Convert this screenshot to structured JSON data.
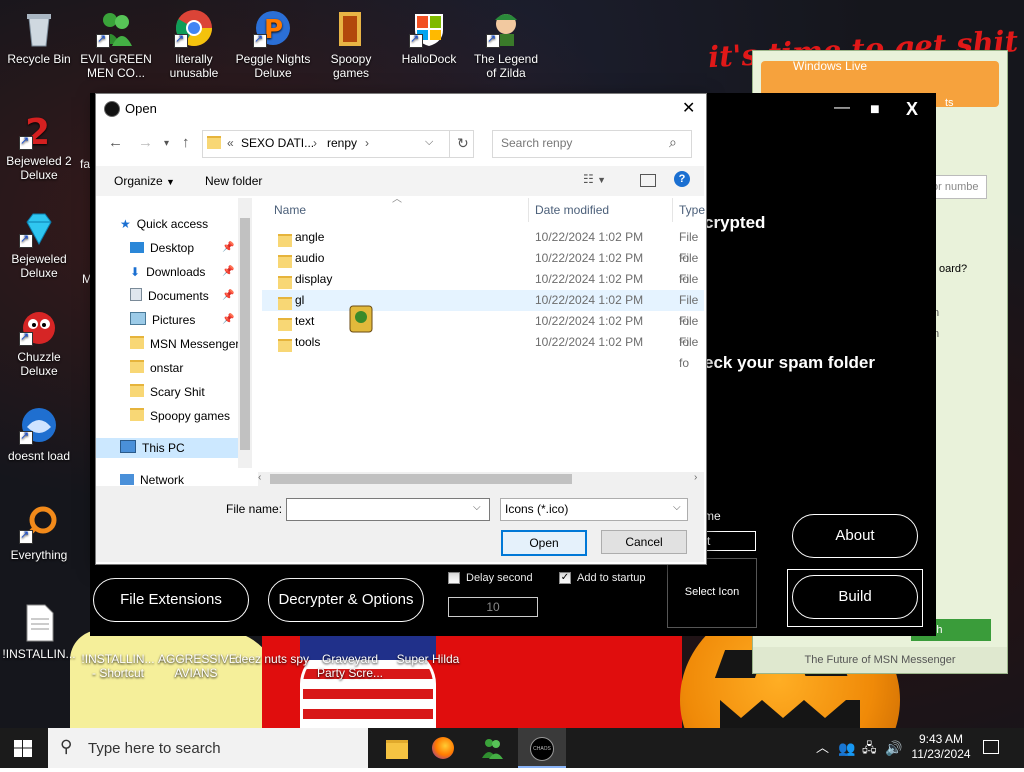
{
  "desktop": {
    "wallpaper_text": "it's time to get shit",
    "top_icons": [
      {
        "label": "Recycle Bin"
      },
      {
        "label": "EVIL GREEN MEN CO..."
      },
      {
        "label": "literally unusable"
      },
      {
        "label": "Peggle Nights Deluxe"
      },
      {
        "label": "Spoopy games"
      },
      {
        "label": "HalloDock"
      },
      {
        "label": "The Legend of Zilda"
      }
    ],
    "left_icons": [
      {
        "label": "Bejeweled 2 Deluxe"
      },
      {
        "label": "Bejeweled Deluxe"
      },
      {
        "label": "Chuzzle Deluxe"
      },
      {
        "label": "doesnt load"
      },
      {
        "label": "Everything"
      },
      {
        "label": "!INSTALLIN..."
      }
    ],
    "clipped_labels": [
      "fa",
      "M"
    ],
    "bottom_icons": [
      {
        "label": "!INSTALLIN... - Shortcut"
      },
      {
        "label": "AGGRESSIVE AVIANS"
      },
      {
        "label": "deez nuts spy"
      },
      {
        "label": "Graveyard Party Scre..."
      },
      {
        "label": "Super Hilda"
      }
    ]
  },
  "msn_window": {
    "title": "Windows Live",
    "bottom_text": "The Future of MSN Messenger",
    "search_label": "earch",
    "side_texts": [
      "or numbe",
      "oard?",
      "n",
      "n",
      "ts"
    ]
  },
  "builder": {
    "window_controls": {
      "minimize": "—",
      "maximize": "■",
      "close": "X"
    },
    "text_encrypted": "crypted",
    "text_spam": "eck your spam folder",
    "text_name": "me",
    "name_input_value": "xt",
    "buttons": {
      "file_extensions": "File Extensions",
      "decrypter_options": "Decrypter & Options",
      "about": "About",
      "build": "Build",
      "select_icon": "Select Icon"
    },
    "delay_second": {
      "label": "Delay second",
      "checked": false,
      "value": "10"
    },
    "add_to_startup": {
      "label": "Add to startup",
      "checked": true
    }
  },
  "dialog": {
    "title": "Open",
    "close": "✕",
    "address": {
      "prefix": "«",
      "segments": [
        "SEXO DATI...",
        "renpy"
      ]
    },
    "search_placeholder": "Search renpy",
    "toolbar": {
      "organize": "Organize",
      "new_folder": "New folder"
    },
    "nav": {
      "quick_access": "Quick access",
      "items": [
        "Desktop",
        "Downloads",
        "Documents",
        "Pictures",
        "MSN Messenger",
        "onstar",
        "Scary Shit",
        "Spoopy games"
      ],
      "this_pc": "This PC",
      "network": "Network"
    },
    "columns": {
      "name": "Name",
      "date_modified": "Date modified",
      "type": "Type"
    },
    "files": [
      {
        "name": "angle",
        "date": "10/22/2024 1:02 PM",
        "type": "File fo"
      },
      {
        "name": "audio",
        "date": "10/22/2024 1:02 PM",
        "type": "File fo"
      },
      {
        "name": "display",
        "date": "10/22/2024 1:02 PM",
        "type": "File fo"
      },
      {
        "name": "gl",
        "date": "10/22/2024 1:02 PM",
        "type": "File fo"
      },
      {
        "name": "text",
        "date": "10/22/2024 1:02 PM",
        "type": "File fo"
      },
      {
        "name": "tools",
        "date": "10/22/2024 1:02 PM",
        "type": "File fo"
      }
    ],
    "file_name_label": "File name:",
    "file_name_value": "",
    "filter": "Icons (*.ico)",
    "open_button": "Open",
    "cancel_button": "Cancel"
  },
  "taskbar": {
    "search_placeholder": "Type here to search",
    "time": "9:43 AM",
    "date": "11/23/2024",
    "chaos_label": "CHAOS"
  }
}
